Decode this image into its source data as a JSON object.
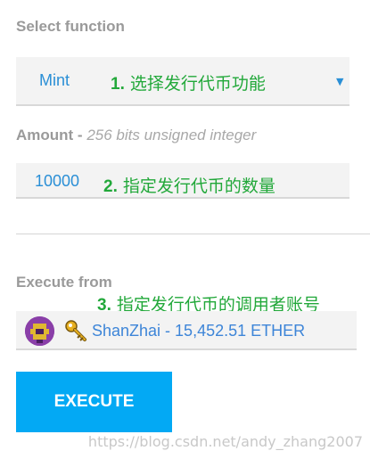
{
  "select_function": {
    "label": "Select function",
    "value": "Mint",
    "annotation_num": "1.",
    "annotation_text": "选择发行代币功能"
  },
  "amount": {
    "label": "Amount - ",
    "hint": "256 bits unsigned integer",
    "value": "10000",
    "annotation_num": "2.",
    "annotation_text": "指定发行代币的数量"
  },
  "execute_from": {
    "label": "Execute from",
    "annotation_num": "3.",
    "annotation_text": "指定发行代币的调用者账号",
    "account": "ShanZhai - 15,452.51 ETHER",
    "icons": {
      "avatar": "identicon-avatar",
      "key": "key-icon"
    }
  },
  "execute_button": {
    "label": "EXECUTE"
  },
  "watermark": "https://blog.csdn.net/andy_zhang2007",
  "colors": {
    "accent": "#03a9f4",
    "value_text": "#2a8fd6",
    "annotation": "#22a83a",
    "label": "#9a9a9a"
  }
}
